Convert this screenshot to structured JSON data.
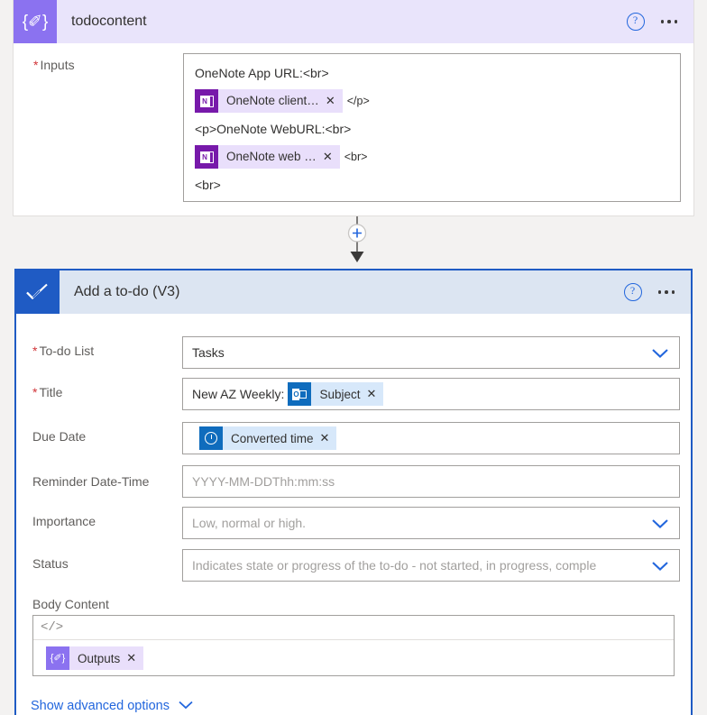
{
  "compose_card": {
    "title": "todocontent",
    "icon": "compose-icon",
    "icon_glyph": "{✐}",
    "help_icon_label": "?",
    "more_menu_label": "…",
    "inputs": {
      "label": "Inputs",
      "required_marker": "*",
      "lines": [
        {
          "type": "text",
          "text": "OneNote App URL:<br>"
        },
        {
          "type": "token",
          "icon": "onenote-icon",
          "icon_letter": "N",
          "label": "OneNote client…",
          "remove_label": "✕",
          "trailing_text": "</p>"
        },
        {
          "type": "text",
          "text": "<p>OneNote WebURL:<br>"
        },
        {
          "type": "token",
          "icon": "onenote-icon",
          "icon_letter": "N",
          "label": "OneNote web …",
          "remove_label": "✕",
          "trailing_text": "<br>"
        },
        {
          "type": "text",
          "text": "<br>"
        }
      ]
    }
  },
  "connector": {
    "add_button_label": "+",
    "arrow_label": "arrow-down"
  },
  "todo_card": {
    "title": "Add a to-do (V3)",
    "icon": "todo-checkmark-icon",
    "help_icon_label": "?",
    "more_menu_label": "…",
    "fields": {
      "todo_list": {
        "label": "To-do List",
        "required_marker": "*",
        "value": "Tasks",
        "chevron": "chevron-down-icon"
      },
      "title": {
        "label": "Title",
        "required_marker": "*",
        "prefix_text": "New AZ Weekly:",
        "token": {
          "icon": "outlook-icon",
          "icon_letter": "O",
          "label": "Subject",
          "remove_label": "✕"
        }
      },
      "due_date": {
        "label": "Due Date",
        "token": {
          "icon": "clock-icon",
          "label": "Converted time",
          "remove_label": "✕"
        }
      },
      "reminder": {
        "label": "Reminder Date-Time",
        "placeholder": "YYYY-MM-DDThh:mm:ss",
        "value": ""
      },
      "importance": {
        "label": "Importance",
        "placeholder": "Low, normal or high.",
        "value": "",
        "chevron": "chevron-down-icon"
      },
      "status": {
        "label": "Status",
        "placeholder": "Indicates state or progress of the to-do - not started, in progress, comple",
        "value": "",
        "chevron": "chevron-down-icon"
      },
      "body_content": {
        "label": "Body Content",
        "code_view_icon": "</>",
        "token": {
          "icon": "compose-icon",
          "icon_glyph": "{✐}",
          "label": "Outputs",
          "remove_label": "✕"
        }
      }
    },
    "show_advanced_options": {
      "label": "Show advanced options",
      "chevron": "chevron-down-icon"
    }
  },
  "colors": {
    "compose_purple": "#8b72f0",
    "compose_header_bg": "#e9e4fb",
    "todo_blue": "#1f5bc4",
    "todo_header_bg": "#dce5f2",
    "onenote_purple": "#7719aa",
    "outlook_blue": "#0f6cbd",
    "link_blue": "#2266dd",
    "required_red": "#d13438",
    "placeholder_gray": "#a19f9d"
  }
}
